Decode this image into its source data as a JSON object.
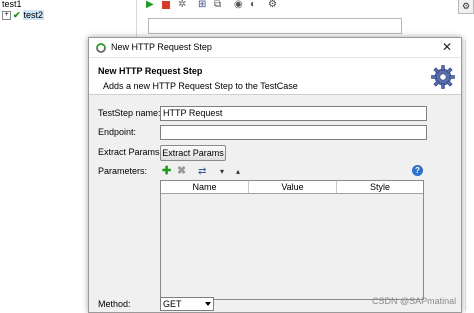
{
  "tree": {
    "items": [
      {
        "label": "test1"
      },
      {
        "label": "test2"
      }
    ]
  },
  "dialog": {
    "title": "New HTTP Request Step",
    "close_glyph": "✕",
    "header_title": "New HTTP Request Step",
    "header_subtitle": "Adds a new HTTP Request Step to the TestCase",
    "fields": {
      "teststep_name_label": "TestStep name:",
      "teststep_name_value": "HTTP Request",
      "endpoint_label": "Endpoint:",
      "endpoint_value": "",
      "extract_params_label": "Extract Params:",
      "extract_params_button": "Extract Params",
      "parameters_label": "Parameters:",
      "method_label": "Method:",
      "method_value": "GET"
    },
    "params_table": {
      "columns": [
        "Name",
        "Value",
        "Style"
      ],
      "rows": []
    },
    "help_glyph": "?"
  },
  "watermark": "CSDN @SAPmatinal",
  "colors": {
    "accent_green": "#1f8b1f",
    "help_blue": "#2f6fce",
    "remove_gray": "#9a9a9a"
  },
  "icons": [
    "run-icon",
    "stop-icon",
    "gear-icon",
    "add-icon",
    "remove-icon",
    "move-up-icon",
    "move-down-icon",
    "help-icon"
  ]
}
